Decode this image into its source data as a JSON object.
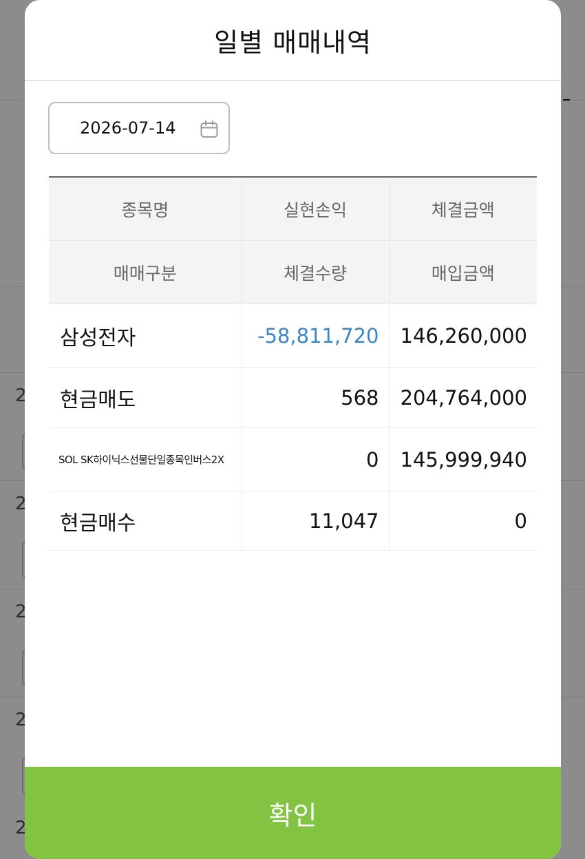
{
  "modal": {
    "title": "일별 매매내역",
    "date": "2026-07-14",
    "confirm_label": "확인"
  },
  "table": {
    "header_row1": [
      "종목명",
      "실현손익",
      "체결금액"
    ],
    "header_row2": [
      "매매구분",
      "체결수량",
      "매입금액"
    ],
    "rows": [
      {
        "c1": "삼성전자",
        "c2": "-58,811,720",
        "c3": "146,260,000"
      },
      {
        "c1": "현금매도",
        "c2": "568",
        "c3": "204,764,000"
      },
      {
        "c1": "SOL SK하이닉스선물단일종목인버스2X",
        "c2": "0",
        "c3": "145,999,940"
      },
      {
        "c1": "현금매수",
        "c2": "11,047",
        "c3": "0"
      }
    ]
  },
  "background": {
    "row_numbers": [
      "2",
      "2",
      "2",
      "2",
      "2"
    ]
  },
  "colors": {
    "accent": "#82c341",
    "negative": "#3b86c6",
    "overlay": "#8c8c8c"
  },
  "icons": {
    "date_picker": "calendar-icon"
  }
}
